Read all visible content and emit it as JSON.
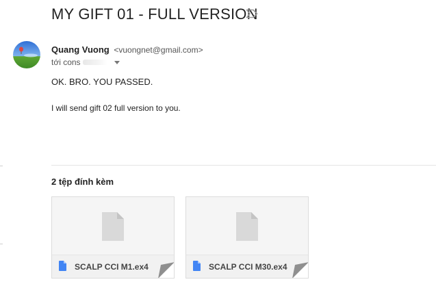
{
  "email": {
    "subject": "MY GIFT 01 - FULL VERSION",
    "sender": {
      "name": "Quang Vuong",
      "email": "<vuongnet@gmail.com>"
    },
    "to_label": "tới cons",
    "body": {
      "line1": "OK. BRO. YOU PASSED.",
      "line2": "I will send gift 02 full version to you."
    }
  },
  "attachments": {
    "title": "2 tệp đính kèm",
    "items": [
      {
        "name": "SCALP CCI M1.ex4",
        "icon": "file-icon"
      },
      {
        "name": "SCALP CCI M30.ex4",
        "icon": "file-icon"
      }
    ]
  },
  "icons": {
    "label": "label-important-icon",
    "avatar": "avatar",
    "caret": "chevron-down-icon",
    "preview": "document-icon",
    "corner": "corner-fold-icon"
  },
  "colors": {
    "file_icon": "#4285f4",
    "preview_doc": "#d9d9d9"
  }
}
